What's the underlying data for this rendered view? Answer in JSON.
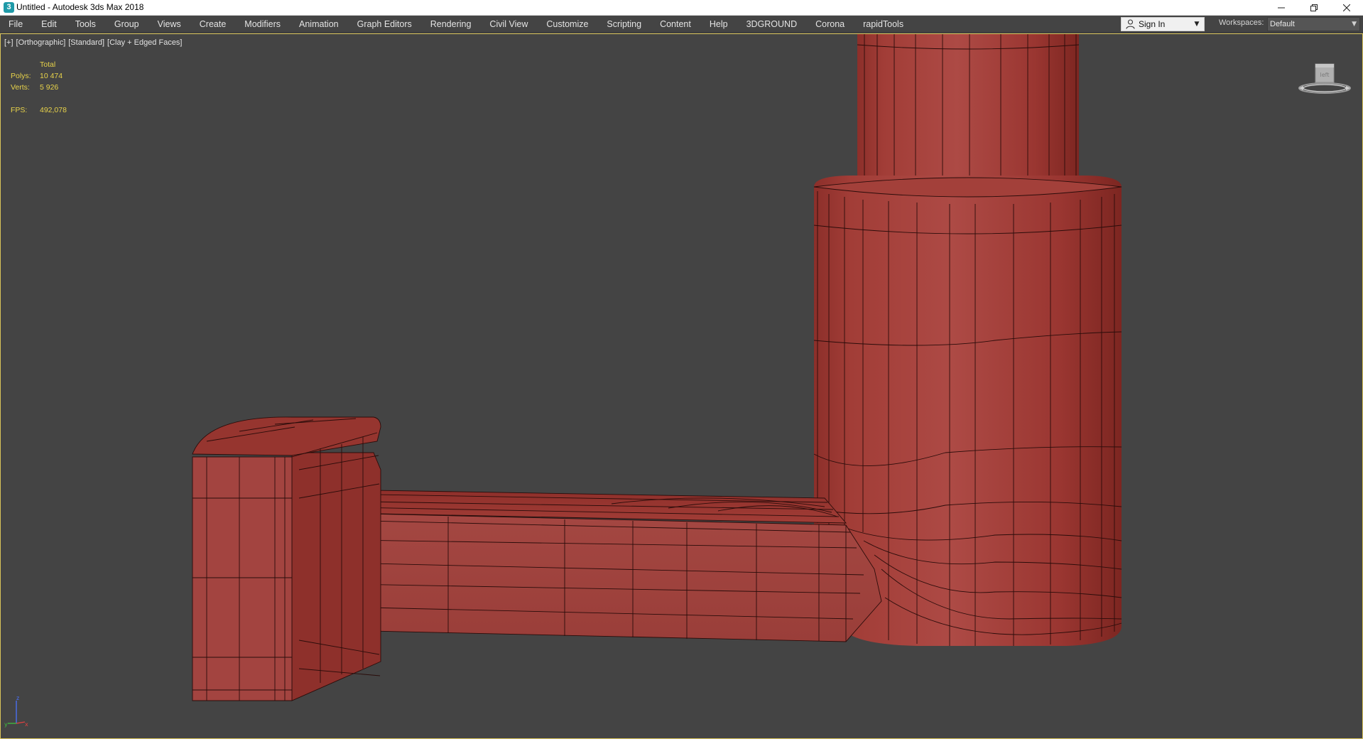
{
  "window": {
    "title": "Untitled - Autodesk 3ds Max 2018",
    "icon": "3ds-max-logo-icon",
    "icon_glyph": "3",
    "controls": [
      "minimize-icon",
      "restore-icon",
      "close-icon"
    ]
  },
  "menu": [
    {
      "label": "File"
    },
    {
      "label": "Edit"
    },
    {
      "label": "Tools"
    },
    {
      "label": "Group"
    },
    {
      "label": "Views"
    },
    {
      "label": "Create"
    },
    {
      "label": "Modifiers"
    },
    {
      "label": "Animation"
    },
    {
      "label": "Graph Editors"
    },
    {
      "label": "Rendering"
    },
    {
      "label": "Civil View"
    },
    {
      "label": "Customize"
    },
    {
      "label": "Scripting"
    },
    {
      "label": "Content"
    },
    {
      "label": "Help"
    },
    {
      "label": "3DGROUND"
    },
    {
      "label": "Corona"
    },
    {
      "label": "rapidTools"
    }
  ],
  "account": {
    "sign_in": "Sign In",
    "icon": "user-icon"
  },
  "workspaces": {
    "label": "Workspaces:",
    "value": "Default"
  },
  "viewport": {
    "labels": [
      "[+]",
      "[Orthographic]",
      "[Standard]",
      "[Clay + Edged Faces]"
    ],
    "stats": {
      "header": "Total",
      "polys_label": "Polys:",
      "polys": "10 474",
      "verts_label": "Verts:",
      "verts": "5 926",
      "fps_label": "FPS:",
      "fps": "492,078"
    },
    "viewcube_face": "left",
    "tripod_axes": [
      "x",
      "y",
      "z"
    ],
    "colors": {
      "background": "#444444",
      "clay": "#a3433e",
      "wire": "#1c0a09",
      "active_border": "#d9c45a",
      "stats_text": "#e8d34a"
    }
  }
}
